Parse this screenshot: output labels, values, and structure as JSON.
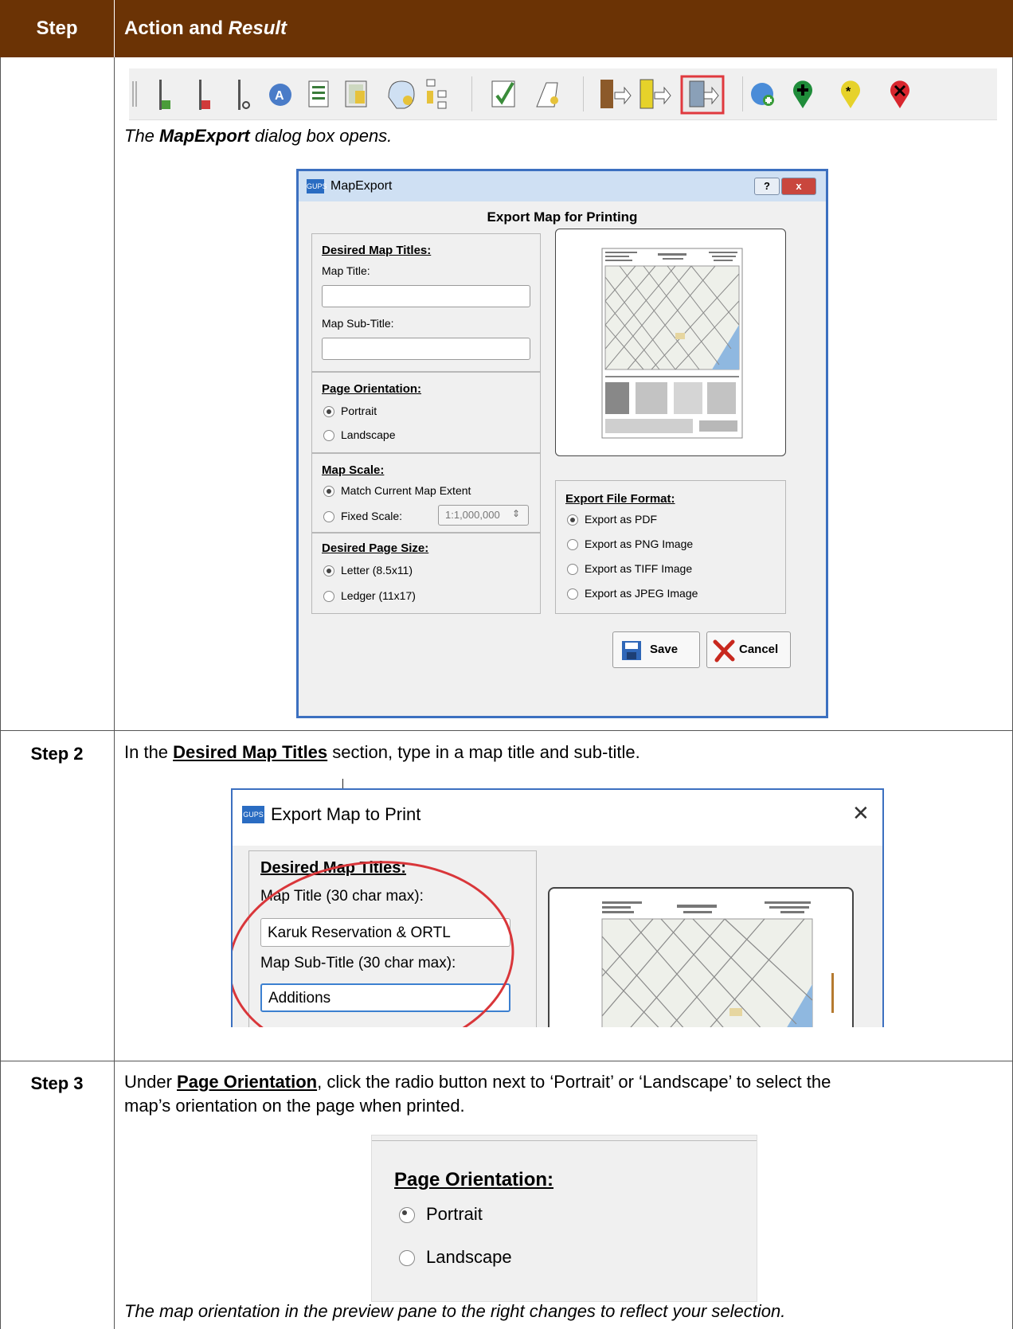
{
  "header": {
    "col1": "Step",
    "col2_plain": "Action and ",
    "col2_italic": "Result"
  },
  "row1": {
    "result_prefix": "The ",
    "result_bold": "MapExport",
    "result_suffix": " dialog box opens."
  },
  "toolbar": {
    "icons": [
      "add-line-icon",
      "remove-line-icon",
      "split-line-icon",
      "label-icon",
      "report-icon",
      "edit-attributes-icon",
      "review-icon",
      "hierarchy-icon",
      "validate-icon",
      "shape-icon",
      "import-icon",
      "export-icon",
      "map-export-icon",
      "add-layer-icon",
      "add-marker-icon",
      "marker-icon",
      "remove-marker-icon"
    ]
  },
  "dialog": {
    "app_icon": "GUPS",
    "title": "MapExport",
    "help_btn": "?",
    "close_btn": "x",
    "heading": "Export Map for Printing",
    "titles_group": "Desired Map Titles:",
    "map_title_label": "Map Title:",
    "map_subtitle_label": "Map Sub-Title:",
    "orientation_group": "Page Orientation:",
    "portrait": "Portrait",
    "landscape": "Landscape",
    "scale_group": "Map Scale:",
    "match_extent": "Match Current Map Extent",
    "fixed_scale": "Fixed Scale:",
    "fixed_scale_value": "1:1,000,000",
    "page_size_group": "Desired Page Size:",
    "letter": "Letter (8.5x11)",
    "ledger": "Ledger (11x17)",
    "format_group": "Export File Format:",
    "fmt_pdf": "Export as PDF",
    "fmt_png": "Export as PNG Image",
    "fmt_tiff": "Export as TIFF Image",
    "fmt_jpeg": "Export as JPEG Image",
    "save": "Save",
    "cancel": "Cancel"
  },
  "row2": {
    "step": "Step 2",
    "text_prefix": "In the ",
    "text_bold": "Desired Map Titles",
    "text_suffix": " section, type in a map title and sub-title.",
    "dialog_title": "Export Map to Print",
    "group": "Desired Map Titles:",
    "title_label": "Map Title (30 char max):",
    "title_value": "Karuk Reservation & ORTL",
    "subtitle_label": "Map Sub-Title (30 char max):",
    "subtitle_value": "Additions"
  },
  "row3": {
    "step": "Step 3",
    "text_prefix": "Under ",
    "text_bold": "Page Orientation",
    "text_suffix": ", click the radio button next to ‘Portrait’ or ‘Landscape’ to select the",
    "text_line2": "map’s orientation on the page when printed.",
    "group": "Page Orientation:",
    "portrait": "Portrait",
    "landscape": "Landscape",
    "result": "The map orientation in the preview pane to the right changes to reflect your selection."
  }
}
